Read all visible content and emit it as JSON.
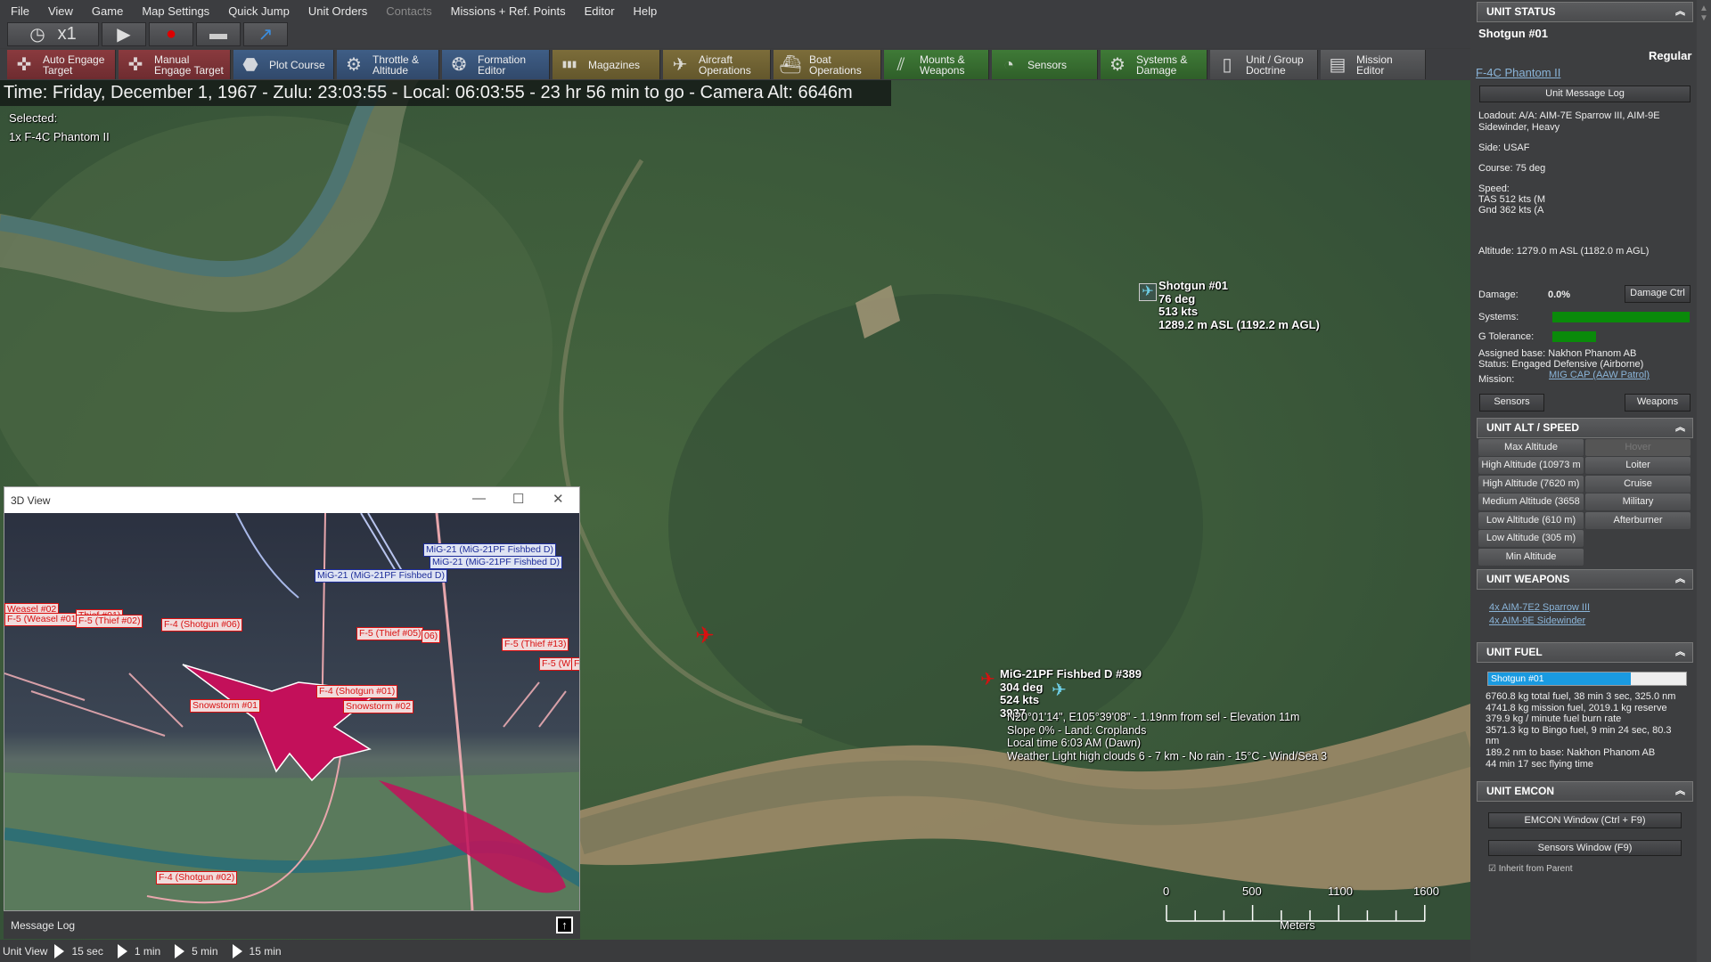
{
  "menu": [
    "File",
    "View",
    "Game",
    "Map Settings",
    "Quick Jump",
    "Unit Orders",
    "Contacts",
    "Missions + Ref. Points",
    "Editor",
    "Help"
  ],
  "menu_disabled": "Contacts",
  "controls": {
    "speed": "x1",
    "clock_icon": "clock-icon",
    "play_icon": "play-icon",
    "record_icon": "record-icon",
    "stop_icon": "stop-icon",
    "jump_icon": "arrow-icon"
  },
  "commands": [
    {
      "label1": "Auto Engage",
      "label2": "Target",
      "color": "red",
      "icon": "crosshair-icon"
    },
    {
      "label1": "Manual",
      "label2": "Engage Target",
      "color": "red",
      "icon": "crosshair-icon"
    },
    {
      "label1": "Plot Course",
      "label2": "",
      "color": "blue",
      "icon": "course-icon"
    },
    {
      "label1": "Throttle &",
      "label2": "Altitude",
      "color": "blue",
      "icon": "throttle-icon"
    },
    {
      "label1": "Formation",
      "label2": "Editor",
      "color": "blue",
      "icon": "formation-icon"
    },
    {
      "label1": "Magazines",
      "label2": "",
      "color": "olive",
      "icon": "ammo-icon"
    },
    {
      "label1": "Aircraft",
      "label2": "Operations",
      "color": "olive",
      "icon": "aircraft-icon"
    },
    {
      "label1": "Boat",
      "label2": "Operations",
      "color": "olive",
      "icon": "boat-icon"
    },
    {
      "label1": "Mounts &",
      "label2": "Weapons",
      "color": "green",
      "icon": "mounts-icon"
    },
    {
      "label1": "Sensors",
      "label2": "",
      "color": "green",
      "icon": "radar-icon"
    },
    {
      "label1": "Systems &",
      "label2": "Damage",
      "color": "green",
      "icon": "gear-icon"
    },
    {
      "label1": "Unit / Group",
      "label2": "Doctrine",
      "color": "grey",
      "icon": "document-icon"
    },
    {
      "label1": "Mission",
      "label2": "Editor",
      "color": "grey",
      "icon": "editor-icon"
    }
  ],
  "timebar": "Time: Friday, December 1, 1967 - Zulu: 23:03:55 - Local: 06:03:55 - 23 hr 56 min to go -  Camera Alt: 6646m",
  "selected": {
    "label": "Selected:",
    "unit": "1x F-4C Phantom II"
  },
  "map": {
    "friendly": {
      "name": "Shotgun #01",
      "course": "76 deg",
      "speed": "513 kts",
      "alt": "1289.2 m ASL (1192.2 m AGL)"
    },
    "hostile": {
      "name": "MiG-21PF Fishbed D #389",
      "course": "304 deg",
      "speed": "524 kts",
      "alt": "3937"
    },
    "cursor_info": [
      "N20°01'14\", E105°39'08\" - 1.19nm from sel - Elevation 11m",
      "Slope 0%  - Land: Croplands",
      "Local time 6:03 AM (Dawn)",
      "Weather Light high clouds 6 - 7 km - No rain - 15°C - Wind/Sea 3"
    ],
    "scale": {
      "ticks": [
        "0",
        "500",
        "1100",
        "1600"
      ],
      "unit": "Meters"
    }
  },
  "view3d": {
    "title": "3D View",
    "labels_blue": [
      "MiG-21 (MiG-21PF Fishbed D)",
      "MiG-21 (MiG-21PF Fishbed D)",
      "MiG-21 (MiG-21PF Fishbed D)"
    ],
    "labels_red": [
      "Weasel #02",
      "F-5 (Weasel #01)",
      "Thief #01)",
      "F-5 (Thief #02)",
      "F-4 (Shotgun #06)",
      "F-5 (Thief #05)",
      "06)",
      "F-5 (Thief #13)",
      "F-5 (W",
      "F",
      "F-4 (Shotgun #01)",
      "Snowstorm #01",
      "Snowstorm #02",
      "F-4 (Shotgun #02)"
    ]
  },
  "message_log": "Message Log",
  "bottom": {
    "label": "Unit View",
    "steps": [
      "15 sec",
      "1 min",
      "5 min",
      "15 min"
    ]
  },
  "panel": {
    "status_header": "UNIT STATUS",
    "unit_name": "Shotgun #01",
    "proficiency": "Regular",
    "class_link": "F-4C Phantom II",
    "message_log_btn": "Unit Message Log",
    "loadout": "Loadout: A/A: AIM-7E Sparrow III, AIM-9E Sidewinder, Heavy",
    "side": "Side: USAF",
    "course": "Course: 75 deg",
    "speed_label": "Speed:",
    "tas": "TAS 512 kts (M",
    "gnd": "Gnd 362 kts (A",
    "altitude": "Altitude: 1279.0 m ASL (1182.0 m AGL)",
    "damage_label": "Damage:",
    "damage_value": "0.0%",
    "damage_btn": "Damage Ctrl",
    "systems_label": "Systems:",
    "systems_pct": 100,
    "g_label": "G Tolerance:",
    "g_pct": 32,
    "base": "Assigned base: Nakhon Phanom AB",
    "status": "Status: Engaged Defensive (Airborne)",
    "mission_label": "Mission:",
    "mission_link": "MIG CAP (AAW Patrol)",
    "sensors_btn": "Sensors",
    "weapons_btn": "Weapons",
    "alt_header": "UNIT ALT / SPEED",
    "alt_buttons": [
      "Max Altitude",
      "High Altitude (10973 m",
      "High Altitude (7620 m)",
      "Medium Altitude (3658",
      "Low Altitude (610 m)",
      "Low Altitude (305 m)",
      "Min Altitude"
    ],
    "speed_buttons": [
      "Hover",
      "Loiter",
      "Cruise",
      "Military",
      "Afterburner"
    ],
    "weapons_header": "UNIT WEAPONS",
    "weapons": [
      "4x AIM-7E2 Sparrow III",
      "4x AIM-9E Sidewinder"
    ],
    "fuel_header": "UNIT FUEL",
    "fuel_bar_label": "Shotgun #01",
    "fuel_pct": 72,
    "fuel_lines": [
      "6760.8 kg total fuel, 38 min 3 sec, 325.0 nm",
      "4741.8 kg mission fuel, 2019.1 kg reserve",
      "379.9 kg / minute fuel burn rate",
      "3571.3 kg to Bingo fuel, 9 min 24 sec, 80.3",
      "nm",
      "189.2 nm to base: Nakhon Phanom AB",
      "44 min 17 sec flying time"
    ],
    "emcon_header": "UNIT EMCON",
    "emcon_btn": "EMCON Window (Ctrl + F9)",
    "sensors_window_btn": "Sensors Window (F9)",
    "inherit": "Inherit from Parent"
  },
  "colors": {
    "hostile": "#d81010",
    "friendly": "#6fd0e8",
    "fuel": "#1a9ae0",
    "ok": "#0a8a0a"
  }
}
